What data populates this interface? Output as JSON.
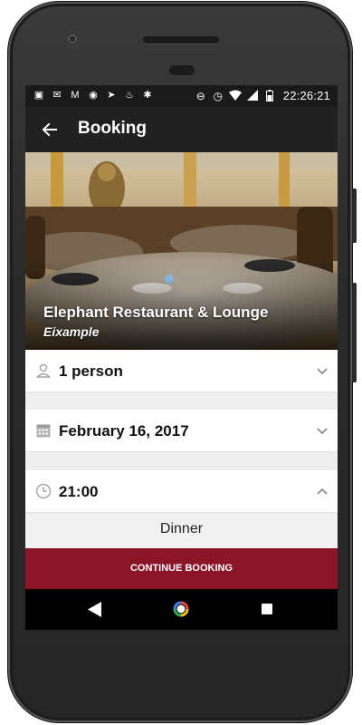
{
  "status_bar": {
    "time": "22:26:21",
    "left_icons": [
      "chat-icon",
      "mail-icon",
      "gmail-icon",
      "download-icon",
      "telegram-icon",
      "coffee-icon",
      "pinwheel-icon"
    ],
    "right_icons": [
      "do-not-disturb-icon",
      "alarm-icon",
      "wifi-icon",
      "signal-icon",
      "battery-icon"
    ]
  },
  "app_bar": {
    "title": "Booking",
    "back_icon": "arrow-back-icon"
  },
  "restaurant": {
    "name": "Elephant Restaurant & Lounge",
    "area": "Eixample"
  },
  "form": {
    "party_size": {
      "value": "1 person",
      "icon": "person-icon"
    },
    "date": {
      "value": "February 16, 2017",
      "icon": "calendar-icon"
    },
    "time": {
      "value": "21:00",
      "icon": "clock-icon",
      "expanded": true
    },
    "meal_option": "Dinner"
  },
  "cta": {
    "label": "CONTINUE BOOKING"
  },
  "colors": {
    "accent": "#8c1428",
    "app_bar": "#212121",
    "status_bar": "#1a1a1a"
  }
}
